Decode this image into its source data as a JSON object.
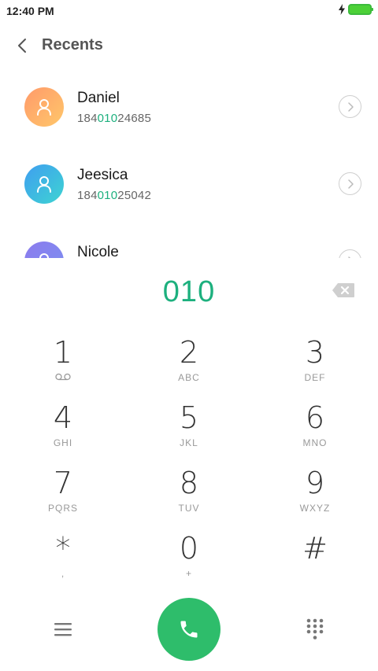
{
  "status_bar": {
    "time": "12:40 PM",
    "icons": [
      "charging-bolt-icon",
      "battery-icon"
    ],
    "battery_color": "#4cd137"
  },
  "header": {
    "back_icon": "chevron-left-icon",
    "title": "Recents"
  },
  "recents": [
    {
      "name": "Daniel",
      "number_parts": [
        "184",
        "010",
        "24685"
      ],
      "avatar_colors": [
        "#ffa26b",
        "#ffc46b"
      ],
      "avatar_icon": "person-icon",
      "action_icon": "chevron-right-icon"
    },
    {
      "name": "Jeesica",
      "number_parts": [
        "184",
        "010",
        "25042"
      ],
      "avatar_colors": [
        "#3fa8ef",
        "#3dd3d3"
      ],
      "avatar_icon": "person-icon",
      "action_icon": "chevron-right-icon"
    },
    {
      "name": "Nicole",
      "number_parts": [
        "",
        "",
        ""
      ],
      "avatar_colors": [
        "#8a7dee",
        "#7b8df0"
      ],
      "avatar_icon": "person-icon",
      "action_icon": "chevron-right-icon"
    }
  ],
  "dialer": {
    "input_value": "010",
    "accent_color": "#1db07e",
    "backspace_icon": "backspace-icon"
  },
  "keypad": {
    "keys": [
      {
        "digit": "1",
        "sub": "",
        "sub_icon": "voicemail-icon"
      },
      {
        "digit": "2",
        "sub": "ABC"
      },
      {
        "digit": "3",
        "sub": "DEF"
      },
      {
        "digit": "4",
        "sub": "GHI"
      },
      {
        "digit": "5",
        "sub": "JKL"
      },
      {
        "digit": "6",
        "sub": "MNO"
      },
      {
        "digit": "7",
        "sub": "PQRS"
      },
      {
        "digit": "8",
        "sub": "TUV"
      },
      {
        "digit": "9",
        "sub": "WXYZ"
      },
      {
        "digit": "*",
        "sub": ","
      },
      {
        "digit": "0",
        "sub": "+"
      },
      {
        "digit": "#",
        "sub": ""
      }
    ]
  },
  "bottom_bar": {
    "menu_icon": "menu-icon",
    "call_icon": "phone-icon",
    "call_color": "#2ebd6b",
    "keypad_icon": "dialpad-icon"
  }
}
